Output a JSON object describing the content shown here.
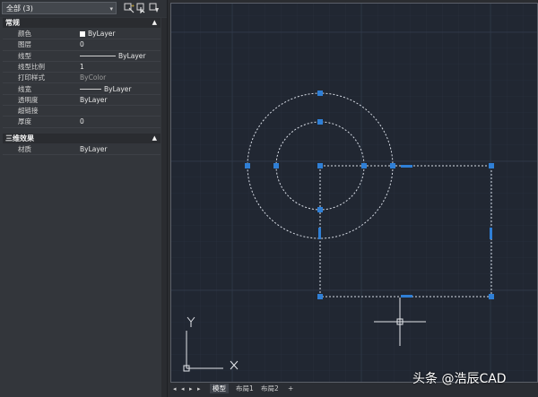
{
  "selector": {
    "value": "全部 (3)"
  },
  "sections": {
    "general": "常规",
    "threed": "三维效果"
  },
  "properties": [
    {
      "key": "颜色",
      "value": "ByLayer",
      "type": "color"
    },
    {
      "key": "图层",
      "value": "0",
      "type": "text"
    },
    {
      "key": "线型",
      "value": "ByLayer",
      "type": "linetype"
    },
    {
      "key": "线型比例",
      "value": "1",
      "type": "text"
    },
    {
      "key": "打印样式",
      "value": "ByColor",
      "type": "dim"
    },
    {
      "key": "线宽",
      "value": "ByLayer",
      "type": "lineweight"
    },
    {
      "key": "透明度",
      "value": "ByLayer",
      "type": "text"
    },
    {
      "key": "超链接",
      "value": "",
      "type": "text"
    },
    {
      "key": "厚度",
      "value": "0",
      "type": "text"
    }
  ],
  "threed_properties": [
    {
      "key": "材质",
      "value": "ByLayer"
    }
  ],
  "tabs": {
    "model": "模型",
    "layout1": "布局1",
    "layout2": "布局2",
    "add": "+"
  },
  "ucs": {
    "x": "X",
    "y": "Y"
  },
  "watermark": "头条 @浩辰CAD",
  "colors": {
    "canvas": "#212732",
    "grip": "#2f7fd6",
    "panel": "#33363b"
  }
}
